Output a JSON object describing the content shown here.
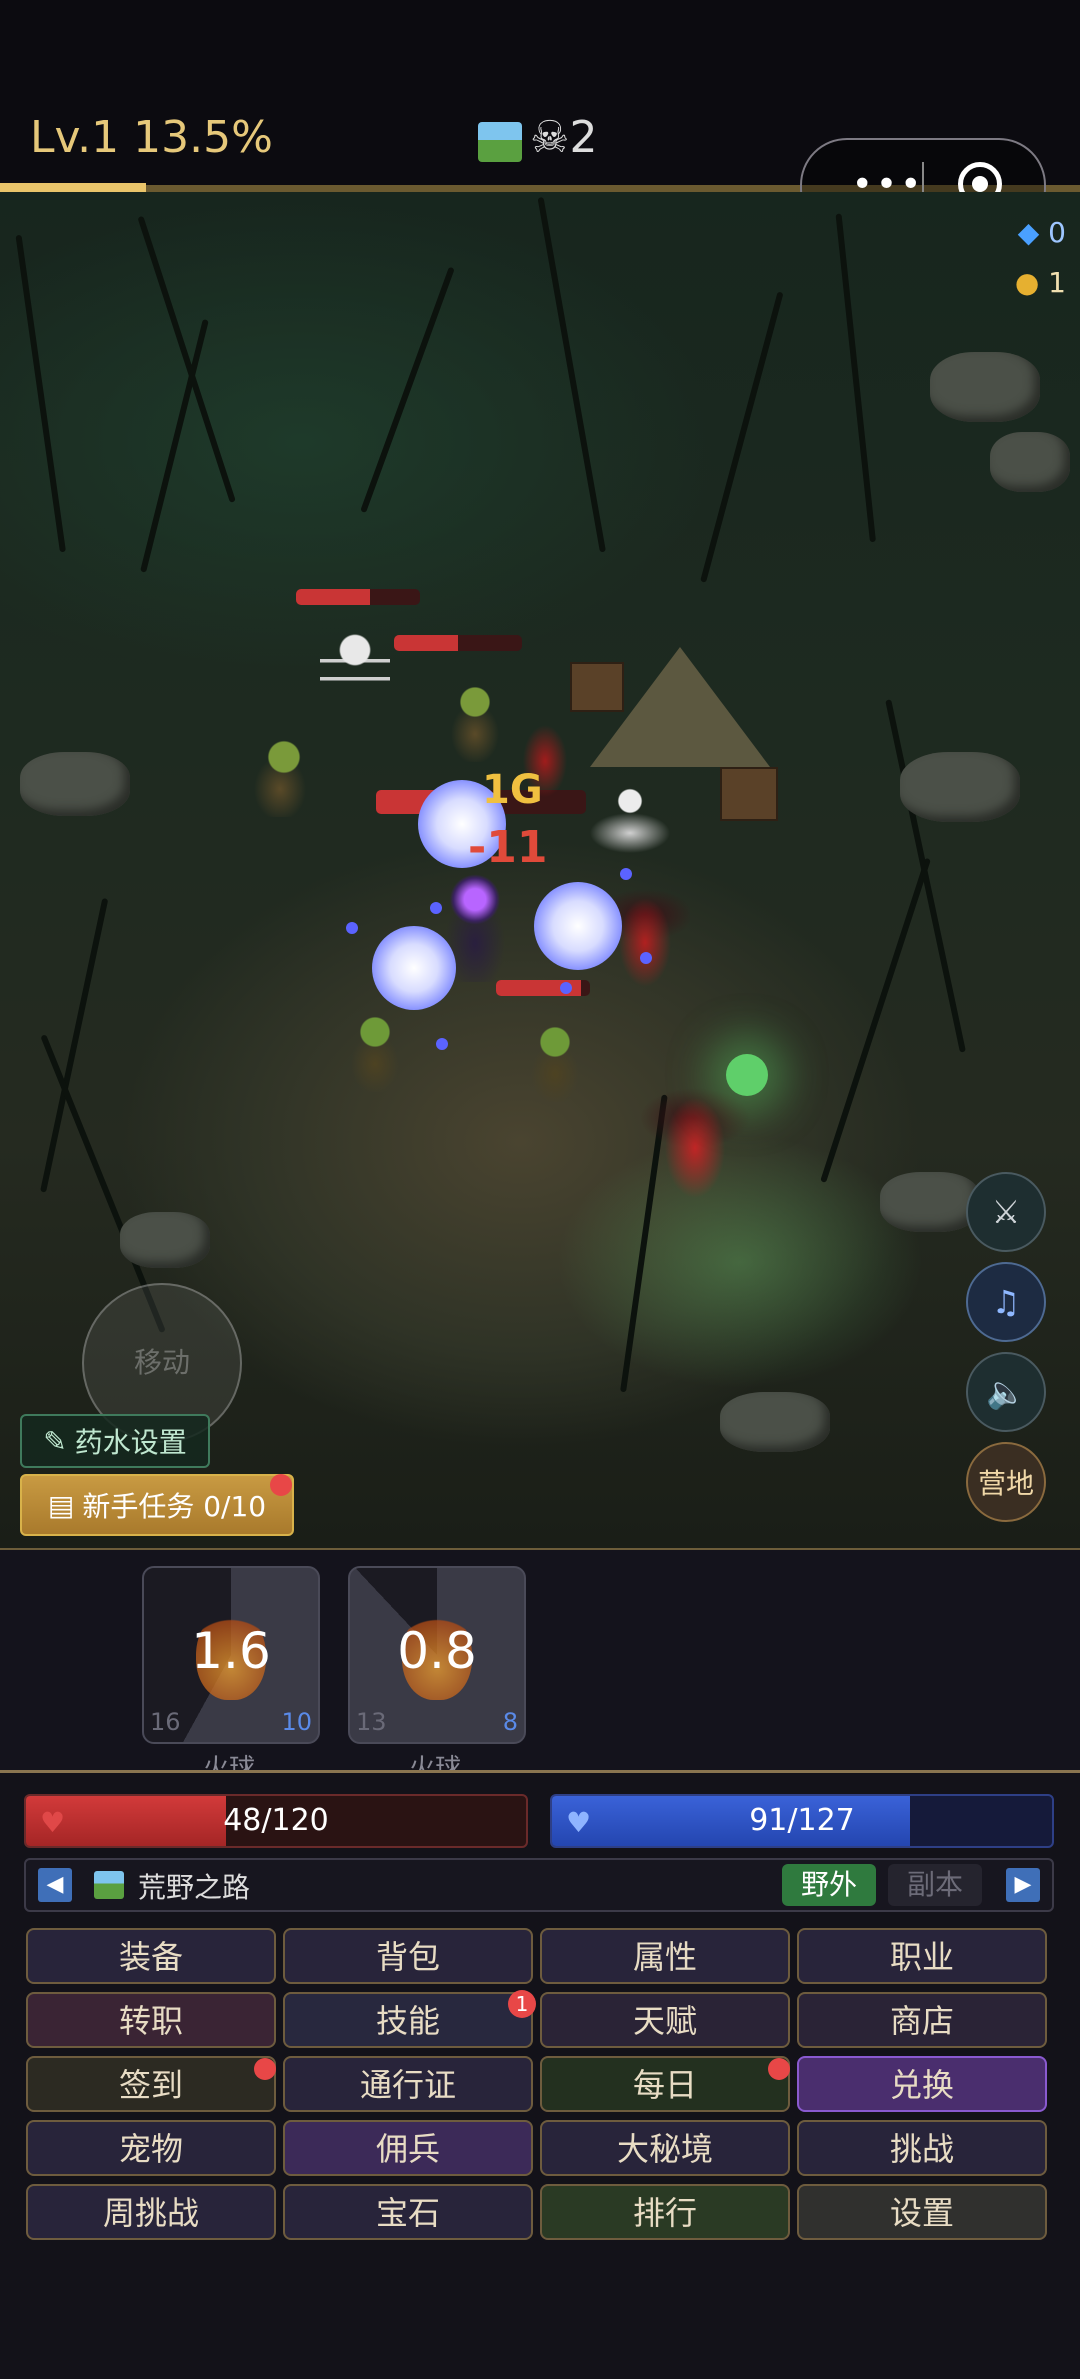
{
  "header": {
    "level_text": "Lv.1 13.5%",
    "xp_progress": 0.135,
    "skull_icon": "skull-crossbones-icon",
    "kill_count": "2",
    "capsule_more": "•••",
    "diamonds": "0",
    "gold": "1"
  },
  "battle": {
    "damage_texts": [
      "1G",
      "-11"
    ],
    "joystick_label": "移动"
  },
  "buttons": {
    "potion": "药水设置",
    "quest": "新手任务 0/10",
    "camp": "营地"
  },
  "skills": [
    {
      "cooldown": "1.6",
      "left": "16",
      "right": "10",
      "name": "火球"
    },
    {
      "cooldown": "0.8",
      "left": "13",
      "right": "8",
      "name": "火球"
    }
  ],
  "stats": {
    "hp_text": "48/120",
    "hp_fraction": 0.4,
    "mp_text": "91/127",
    "mp_fraction": 0.7165
  },
  "map": {
    "name": "荒野之路",
    "tab_field": "野外",
    "tab_dungeon": "副本"
  },
  "menu": [
    [
      "装备",
      "背包",
      "属性",
      "职业"
    ],
    [
      "转职",
      "技能",
      "天赋",
      "商店"
    ],
    [
      "签到",
      "通行证",
      "每日",
      "兑换"
    ],
    [
      "宠物",
      "佣兵",
      "大秘境",
      "挑战"
    ],
    [
      "周挑战",
      "宝石",
      "排行",
      "设置"
    ]
  ],
  "badges": {
    "skills": "1"
  },
  "colors": {
    "gold": "#e6c87a",
    "hp": "#c93535",
    "mp": "#2f56c8"
  }
}
